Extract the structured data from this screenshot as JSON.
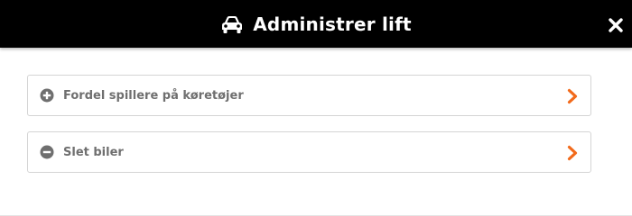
{
  "header": {
    "title": "Administrer lift",
    "icon": "car-icon",
    "close_icon": "close-icon",
    "background_color": "#000000",
    "text_color": "#ffffff"
  },
  "options": [
    {
      "label": "Fordel spillere på køretøjer",
      "icon": "plus-circle-icon",
      "chevron": "chevron-right-icon"
    },
    {
      "label": "Slet biler",
      "icon": "minus-circle-icon",
      "chevron": "chevron-right-icon"
    }
  ],
  "colors": {
    "accent": "#f26a1b",
    "label": "#6f6f6f",
    "border": "#d4d4d4"
  }
}
